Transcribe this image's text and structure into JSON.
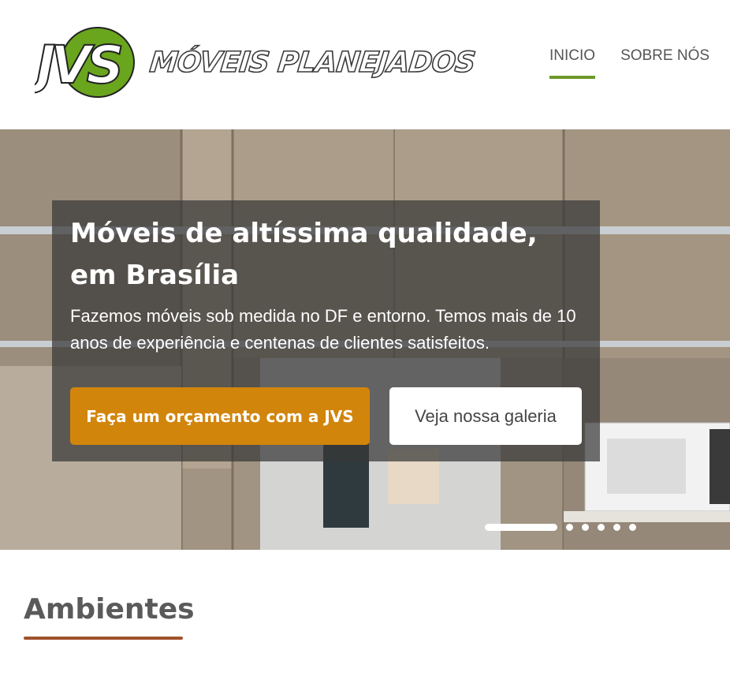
{
  "brand": {
    "logo_letters": "JVS",
    "wordmark": "MÓVEIS PLANEJADOS",
    "logo_green": "#6aa51e"
  },
  "nav": {
    "items": [
      {
        "label": "INICIO",
        "active": true
      },
      {
        "label": "SOBRE NÓS",
        "active": false
      }
    ],
    "accent": "#6c9a2a"
  },
  "hero": {
    "title": "Móveis de altíssima qualidade, em Brasília",
    "text": "Fazemos móveis sob medida no DF e entorno. Temos mais de 10 anos de experiência e centenas de clientes satisfeitos.",
    "primary_cta": "Faça um orçamento com a JVS",
    "secondary_cta": "Veja nossa galeria",
    "primary_color": "#d2850b",
    "slides_count": 6,
    "active_slide": 1
  },
  "section": {
    "title": "Ambientes",
    "underline_color": "#a0522d"
  }
}
